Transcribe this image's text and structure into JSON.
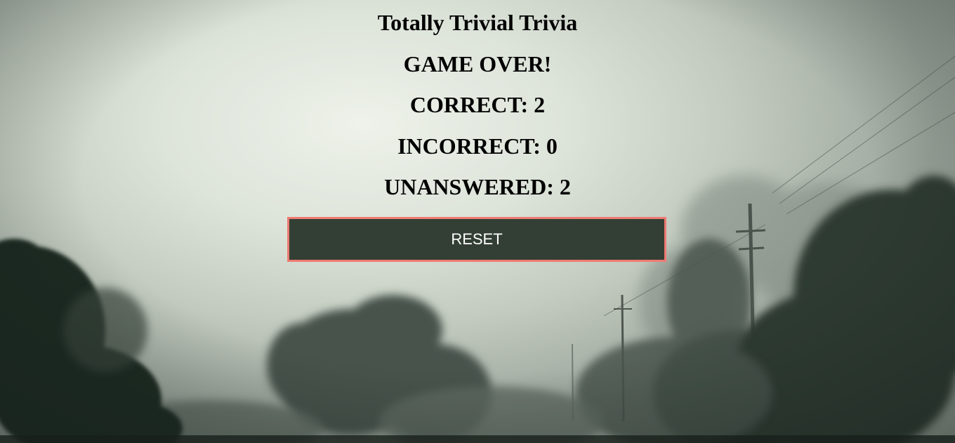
{
  "page": {
    "title": "Totally Trivial Trivia"
  },
  "results": {
    "game_over": "GAME OVER!",
    "correct": "CORRECT: 2",
    "incorrect": "INCORRECT: 0",
    "unanswered": "UNANSWERED: 2"
  },
  "actions": {
    "reset_label": "RESET"
  },
  "colors": {
    "button_bg": "#333f34",
    "button_border": "#ef7b73",
    "button_text": "#ffffff"
  }
}
